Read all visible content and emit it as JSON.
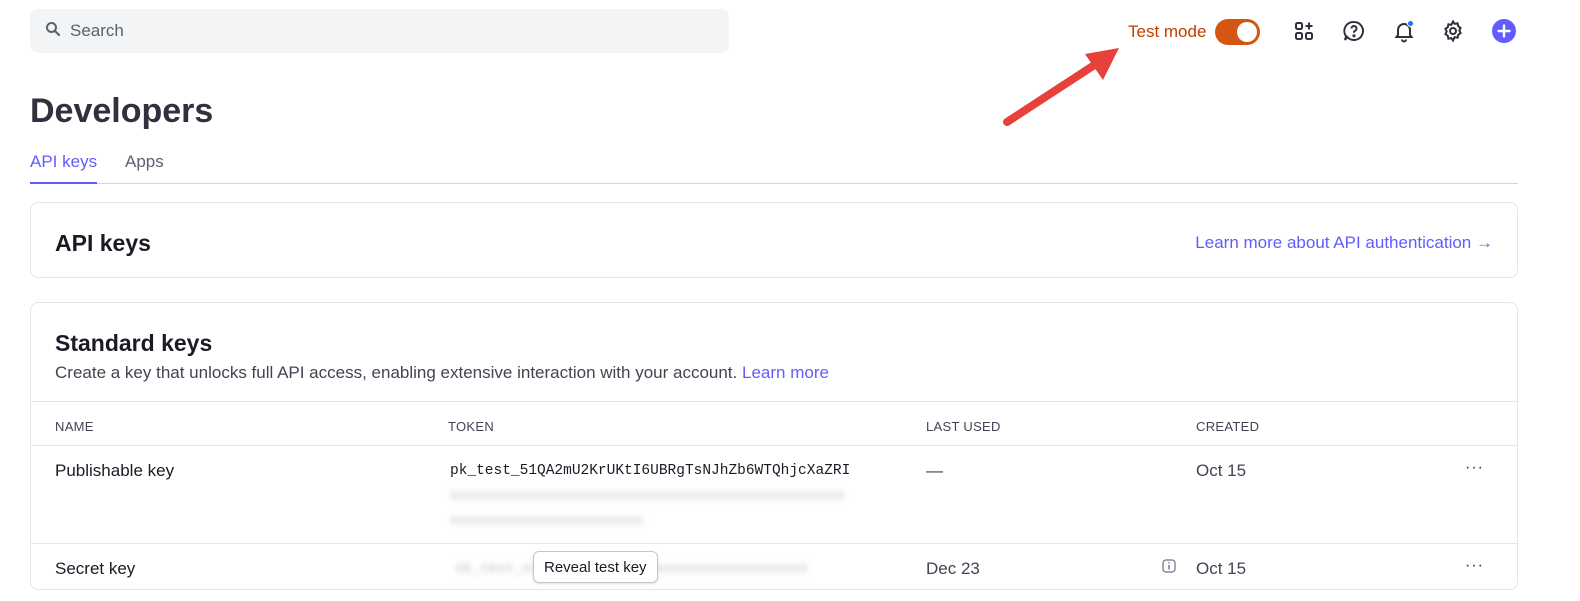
{
  "search": {
    "placeholder": "Search"
  },
  "topbar": {
    "test_mode_label": "Test mode",
    "test_mode_on": true,
    "icons": [
      "apps-add-icon",
      "help-icon",
      "bell-icon",
      "gear-icon",
      "plus-icon"
    ]
  },
  "colors": {
    "accent": "#635bff",
    "test_mode": "#d45514",
    "annotation_arrow": "#e8403a"
  },
  "page": {
    "title": "Developers",
    "tabs": [
      {
        "label": "API keys",
        "active": true
      },
      {
        "label": "Apps",
        "active": false
      }
    ]
  },
  "api_keys_card": {
    "title": "API keys",
    "learn_link": "Learn more about API authentication →"
  },
  "standard_keys": {
    "title": "Standard keys",
    "description": "Create a key that unlocks full API access, enabling extensive interaction with your account.",
    "learn_more": "Learn more",
    "columns": [
      "NAME",
      "TOKEN",
      "LAST USED",
      "CREATED"
    ],
    "rows": [
      {
        "name": "Publishable key",
        "token": "pk_test_51QA2mU2KrUKtI6UBRgTsNJhZb6WTQhjcXaZRI",
        "token_more_1": "xxxxxxxxxxxxxxxxxxxxxxxxxxxxxxxxxxxxxxxxxxxxxxx",
        "token_more_2": "xxxxxxxxxxxxxxxxxxxxxxx",
        "last_used": "—",
        "created": "Oct 15",
        "more": "···"
      },
      {
        "name": "Secret key",
        "token_masked": "sk_test_xxxxxxxxxxxxxxxxxxxxxxxxxxxxxxxxxx",
        "reveal_label": "Reveal test key",
        "last_used": "Dec 23",
        "created": "Oct 15",
        "more": "···"
      }
    ]
  }
}
